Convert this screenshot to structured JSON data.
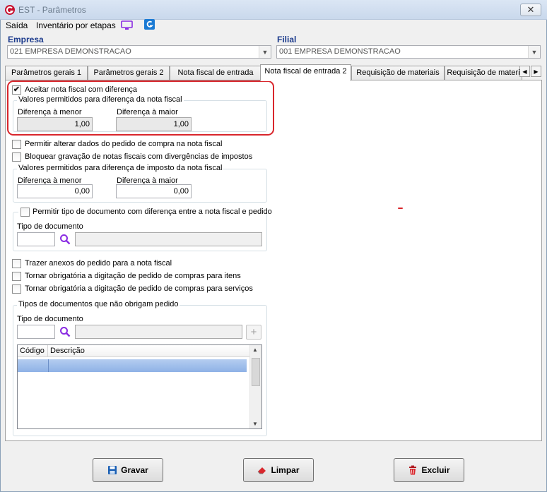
{
  "window": {
    "title": "EST - Parâmetros",
    "close_label": "✕"
  },
  "menu": {
    "items": [
      "Saída",
      "Inventário por etapas"
    ]
  },
  "empresa": {
    "label": "Empresa",
    "value": "021 EMPRESA DEMONSTRACAO"
  },
  "filial": {
    "label": "Filial",
    "value": "001 EMPRESA DEMONSTRACAO"
  },
  "tabs": [
    {
      "label": "Parâmetros gerais 1"
    },
    {
      "label": "Parâmetros gerais 2"
    },
    {
      "label": "Nota fiscal de entrada"
    },
    {
      "label": "Nota fiscal de entrada 2",
      "active": true
    },
    {
      "label": "Requisição de materiais"
    },
    {
      "label": "Requisição de materi"
    }
  ],
  "nf": {
    "aceitar": {
      "label": "Aceitar nota fiscal com diferença",
      "checked": true
    },
    "valores_group": "Valores permitidos para diferença da nota fiscal",
    "dif_menor_label": "Diferença à menor",
    "dif_menor_value": "1,00",
    "dif_maior_label": "Diferença à maior",
    "dif_maior_value": "1,00",
    "permitir_alterar": "Permitir alterar dados do pedido de compra na nota fiscal",
    "bloquear": "Bloquear gravação de notas fiscais com divergências de impostos",
    "imposto_group": "Valores permitidos para diferença de imposto da nota fiscal",
    "imp_menor_label": "Diferença à menor",
    "imp_menor_value": "0,00",
    "imp_maior_label": "Diferença à maior",
    "imp_maior_value": "0,00",
    "permitir_tipo": "Permitir tipo de documento com diferença entre a nota fiscal e pedido",
    "tipo_doc_label": "Tipo de documento",
    "trazer_anexos": "Trazer anexos do pedido para a nota fiscal",
    "obrig_itens": "Tornar obrigatória a digitação de pedido de compras para itens",
    "obrig_servicos": "Tornar obrigatória a digitação de pedido de compras para serviços",
    "tipos_group": "Tipos de documentos que não obrigam pedido",
    "tipo_doc_label2": "Tipo de documento",
    "grid_cols": [
      "Código",
      "Descrição"
    ]
  },
  "buttons": {
    "gravar": "Gravar",
    "limpar": "Limpar",
    "excluir": "Excluir"
  },
  "colors": {
    "highlight": "#d9262c",
    "accent_purple": "#8a2be2",
    "logo_red": "#c8102e",
    "icon_blue": "#1a7ad4"
  }
}
